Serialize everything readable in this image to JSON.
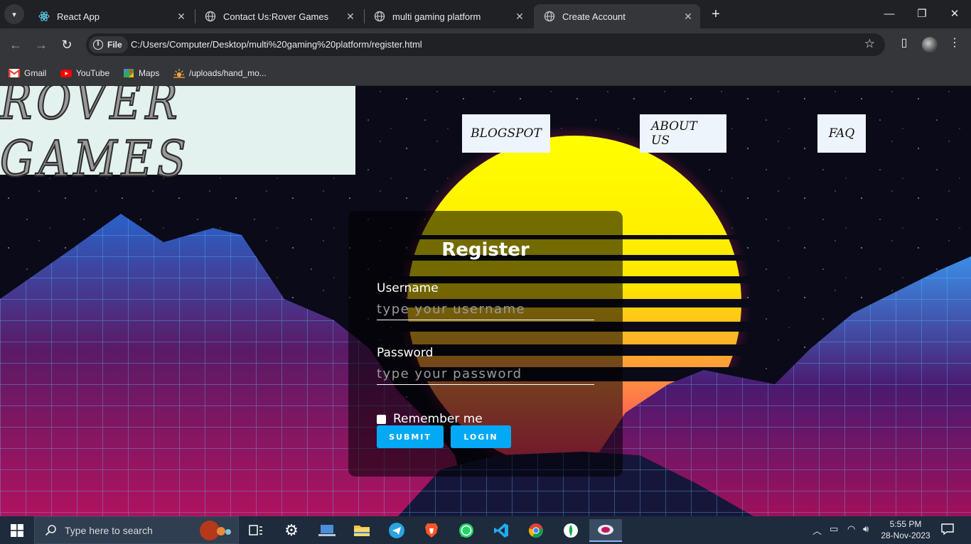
{
  "browser": {
    "tabs": [
      {
        "title": "React App",
        "icon": "react-icon"
      },
      {
        "title": "Contact Us:Rover Games",
        "icon": "globe-icon"
      },
      {
        "title": "multi gaming platform",
        "icon": "globe-icon"
      },
      {
        "title": "Create Account",
        "icon": "globe-icon",
        "active": true
      }
    ],
    "site_chip": "File",
    "url": "C:/Users/Computer/Desktop/multi%20gaming%20platform/register.html",
    "bookmarks": [
      {
        "label": "Gmail",
        "icon": "gmail-icon"
      },
      {
        "label": "YouTube",
        "icon": "youtube-icon"
      },
      {
        "label": "Maps",
        "icon": "maps-icon"
      },
      {
        "label": "/uploads/hand_mo...",
        "icon": "sun-icon"
      }
    ]
  },
  "page": {
    "logo": "ROVER GAMES",
    "nav": [
      "BLOGSPOT",
      "ABOUT US",
      "FAQ"
    ],
    "form": {
      "title": "Register",
      "username_label": "Username",
      "username_placeholder": "type your username",
      "password_label": "Password",
      "password_placeholder": "type your password",
      "remember_label": "Remember me",
      "submit_label": "SUBMIT",
      "login_label": "LOGIN"
    }
  },
  "taskbar": {
    "search_placeholder": "Type here to search",
    "time": "5:55 PM",
    "date": "28-Nov-2023",
    "pinned": [
      "task-view-icon",
      "settings-icon",
      "laptop-icon",
      "file-explorer-icon",
      "telegram-icon",
      "brave-icon",
      "whatsapp-icon",
      "vscode-icon",
      "chrome-icon",
      "mongodb-icon",
      "app-icon"
    ]
  },
  "colors": {
    "accent_button": "#03a9f4",
    "taskbar_bg": "#1d2b3c",
    "chrome_dark": "#202124",
    "chrome_toolbar": "#35363a"
  }
}
